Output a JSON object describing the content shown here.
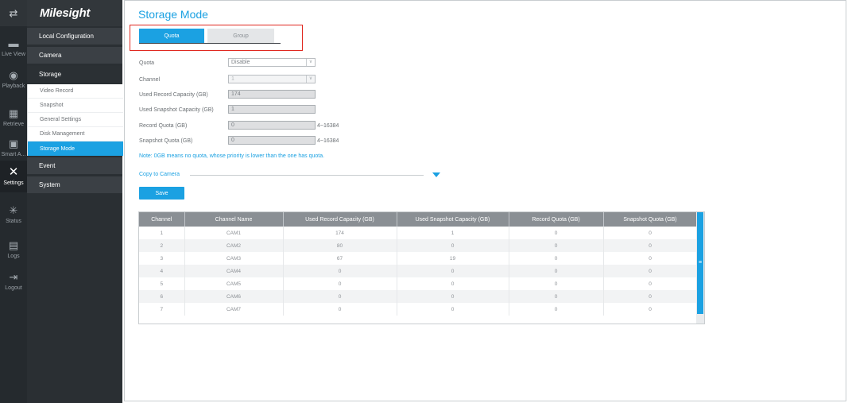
{
  "rail": {
    "items": [
      {
        "icon": "live-view-icon",
        "label": "Live View"
      },
      {
        "icon": "playback-icon",
        "label": "Playback"
      },
      {
        "icon": "retrieve-icon",
        "label": "Retrieve"
      },
      {
        "icon": "smart-analysis-icon",
        "label": "Smart A..."
      },
      {
        "icon": "settings-icon",
        "label": "Settings"
      },
      {
        "icon": "status-icon",
        "label": "Status"
      },
      {
        "icon": "logs-icon",
        "label": "Logs"
      },
      {
        "icon": "logout-icon",
        "label": "Logout"
      }
    ]
  },
  "brand": "Milesight",
  "menu": {
    "local_configuration": "Local Configuration",
    "camera": "Camera",
    "storage": "Storage",
    "storage_sub": [
      "Video Record",
      "Snapshot",
      "General Settings",
      "Disk Management",
      "Storage Mode"
    ],
    "event": "Event",
    "system": "System"
  },
  "page": {
    "title": "Storage Mode",
    "tabs": {
      "quota": "Quota",
      "group": "Group"
    }
  },
  "form": {
    "quota": {
      "label": "Quota",
      "value": "Disable"
    },
    "channel": {
      "label": "Channel",
      "value": "1"
    },
    "used_record": {
      "label": "Used Record Capacity (GB)",
      "value": "174"
    },
    "used_snapshot": {
      "label": "Used Snapshot Capacity (GB)",
      "value": "1"
    },
    "record_quota": {
      "label": "Record Quota (GB)",
      "value": "0",
      "range": "4~16384"
    },
    "snapshot_quota": {
      "label": "Snapshot Quota (GB)",
      "value": "0",
      "range": "4~16384"
    }
  },
  "note": "Note: 0GB means no quota, whose priority is lower than the one has quota.",
  "copy_to_camera": "Copy to Camera",
  "save_label": "Save",
  "table": {
    "headers": [
      "Channel",
      "Channel Name",
      "Used Record Capacity (GB)",
      "Used Snapshot Capacity (GB)",
      "Record Quota (GB)",
      "Snapshot Quota (GB)"
    ],
    "rows": [
      [
        "1",
        "CAM1",
        "174",
        "1",
        "0",
        "0"
      ],
      [
        "2",
        "CAM2",
        "80",
        "0",
        "0",
        "0"
      ],
      [
        "3",
        "CAM3",
        "67",
        "19",
        "0",
        "0"
      ],
      [
        "4",
        "CAM4",
        "0",
        "0",
        "0",
        "0"
      ],
      [
        "5",
        "CAM5",
        "0",
        "0",
        "0",
        "0"
      ],
      [
        "6",
        "CAM6",
        "0",
        "0",
        "0",
        "0"
      ],
      [
        "7",
        "CAM7",
        "0",
        "0",
        "0",
        "0"
      ]
    ]
  },
  "colors": {
    "accent": "#1ba1e2",
    "highlight": "#e0281f"
  }
}
